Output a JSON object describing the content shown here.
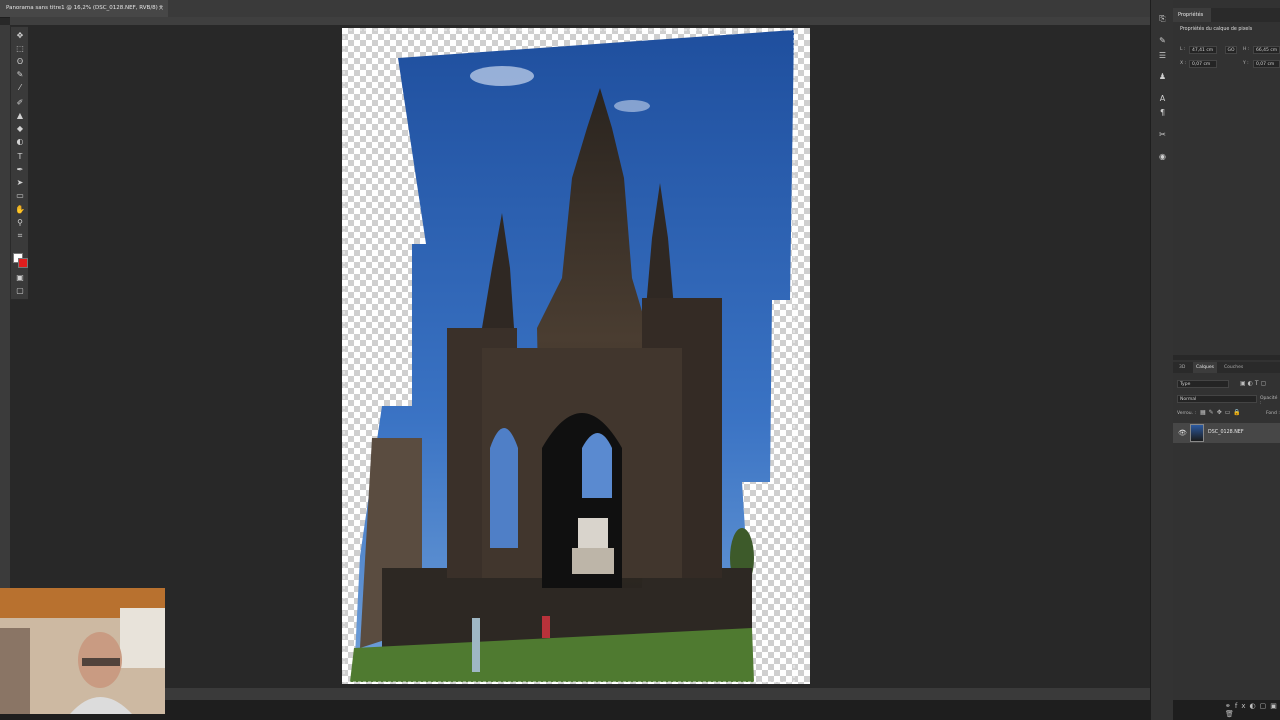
{
  "document": {
    "tab_title": "Panorama sans titre1 @ 16,2% (DSC_0128.NEF, RVB/8) *",
    "close_glyph": "×"
  },
  "properties_panel": {
    "tab_label": "Propriétés",
    "section_title": "Propriétés du calque de pixels",
    "width_label": "L :",
    "width_value": "47,41 cm",
    "link_label": "GO",
    "height_label": "H :",
    "height_value": "66,45 cm",
    "x_label": "X :",
    "x_value": "0,07 cm",
    "y_label": "Y :",
    "y_value": "0,07 cm"
  },
  "layers_panel": {
    "tabs": [
      "3D",
      "Calques",
      "Couches"
    ],
    "active_tab": "Calques",
    "filter_value": "Type",
    "blend_mode": "Normal",
    "opacity_label": "Opacité :",
    "lock_label": "Verrou. :",
    "fill_label": "Fond :",
    "layer_name": "DSC_0128.NEF"
  },
  "icons": {
    "tools": [
      "move-icon",
      "marquee-icon",
      "lasso-icon",
      "quick-select-icon",
      "eyedropper-icon",
      "brush-icon",
      "stamp-icon",
      "eraser-icon",
      "gradient-icon",
      "text-icon",
      "pen-icon",
      "path-select-icon",
      "shape-icon",
      "hand-icon",
      "zoom-icon",
      "crop-icon"
    ],
    "colors": {
      "foreground": "#ffffff",
      "background": "#e01e1e",
      "accent": "#2c5aa0"
    }
  }
}
